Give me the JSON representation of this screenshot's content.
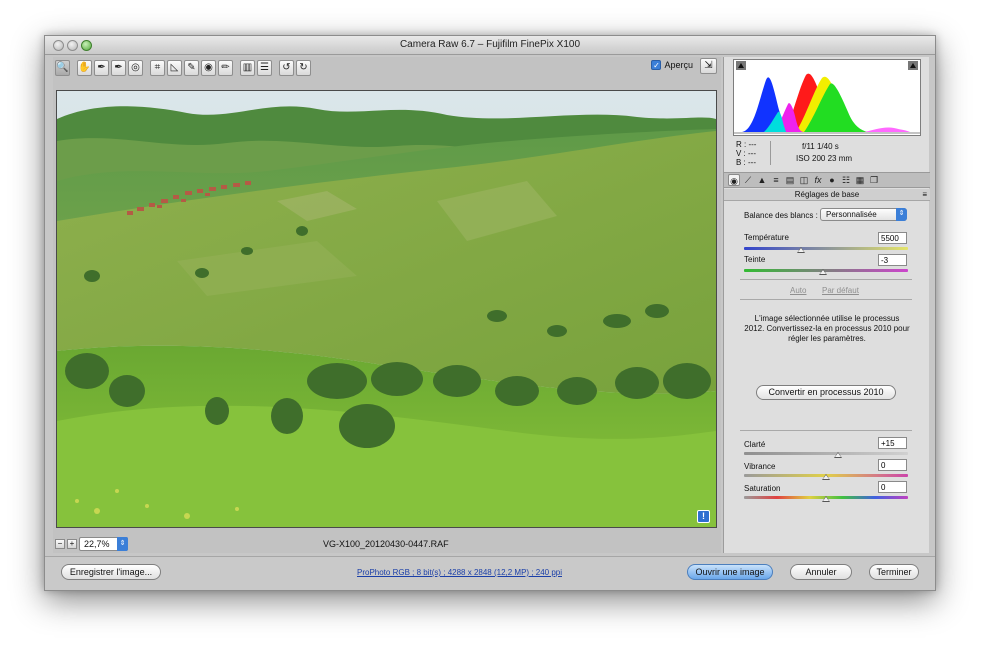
{
  "window": {
    "title": "Camera Raw 6.7  –  Fujifilm FinePix X100"
  },
  "toolbar": {
    "tools": [
      {
        "name": "zoom-tool",
        "glyph": "🔍"
      },
      {
        "name": "hand-tool",
        "glyph": "✋"
      },
      {
        "name": "white-balance-tool",
        "glyph": "✒"
      },
      {
        "name": "color-sampler-tool",
        "glyph": "✒"
      },
      {
        "name": "targeted-adjustment-tool",
        "glyph": "◎"
      },
      {
        "name": "crop-tool",
        "glyph": "⌗"
      },
      {
        "name": "straighten-tool",
        "glyph": "◺"
      },
      {
        "name": "spot-removal-tool",
        "glyph": "✎"
      },
      {
        "name": "red-eye-tool",
        "glyph": "◉"
      },
      {
        "name": "adjustment-brush-tool",
        "glyph": "✏"
      },
      {
        "name": "graduated-filter-tool",
        "glyph": "▥"
      },
      {
        "name": "preferences-tool",
        "glyph": "☰"
      },
      {
        "name": "rotate-left-tool",
        "glyph": "↺"
      },
      {
        "name": "rotate-right-tool",
        "glyph": "↻"
      }
    ],
    "preview_label": "Aperçu",
    "preview_checked": true
  },
  "zoom": {
    "value": "22,7%",
    "minus": "−",
    "plus": "+"
  },
  "filename": "VG-X100_20120430-0447.RAF",
  "readout": {
    "r": "R :   ---",
    "v": "V :   ---",
    "b": "B :   ---",
    "aperture_shutter": "f/11   1/40 s",
    "iso_focal": "ISO 200   23 mm"
  },
  "panel": {
    "title": "Réglages de base",
    "white_balance_label": "Balance des blancs :",
    "white_balance_value": "Personnalisée",
    "temperature_label": "Température",
    "temperature_value": "5500",
    "tint_label": "Teinte",
    "tint_value": "-3",
    "auto_label": "Auto",
    "default_label": "Par défaut",
    "process_message": "L'image sélectionnée utilise le processus 2012. Convertissez-la en processus 2010 pour régler les paramètres.",
    "convert_button": "Convertir en processus 2010",
    "clarity_label": "Clarté",
    "clarity_value": "+15",
    "vibrance_label": "Vibrance",
    "vibrance_value": "0",
    "saturation_label": "Saturation",
    "saturation_value": "0"
  },
  "bottom": {
    "save_button": "Enregistrer l'image...",
    "workflow_link": "ProPhoto RGB ; 8 bit(s) ; 4288 x 2848 (12,2 MP) ; 240 ppi",
    "open_button": "Ouvrir une image",
    "cancel_button": "Annuler",
    "done_button": "Terminer"
  }
}
